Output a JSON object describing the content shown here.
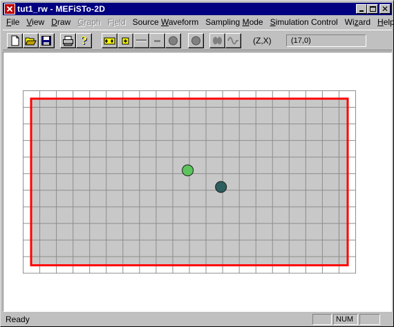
{
  "window": {
    "title": "tut1_rw - MEFiSTo-2D"
  },
  "menu": [
    {
      "pre": "",
      "u": "F",
      "post": "ile",
      "enabled": true
    },
    {
      "pre": "",
      "u": "V",
      "post": "iew",
      "enabled": true
    },
    {
      "pre": "",
      "u": "D",
      "post": "raw",
      "enabled": true
    },
    {
      "pre": "",
      "u": "G",
      "post": "raph",
      "enabled": false
    },
    {
      "pre": "F",
      "u": "i",
      "post": "eld",
      "enabled": false
    },
    {
      "pre": "Source ",
      "u": "W",
      "post": "aveform",
      "enabled": true
    },
    {
      "pre": "Sampling ",
      "u": "M",
      "post": "ode",
      "enabled": true
    },
    {
      "pre": "",
      "u": "S",
      "post": "imulation Control",
      "enabled": true
    },
    {
      "pre": "Wi",
      "u": "z",
      "post": "ard",
      "enabled": true
    },
    {
      "pre": "",
      "u": "H",
      "post": "elp",
      "enabled": true
    }
  ],
  "toolbar": {
    "coord_label": "(Z,X)",
    "coord_value": "(17,0)",
    "icons": [
      "new-file-icon",
      "open-folder-icon",
      "save-disk-icon",
      "print-icon",
      "help-question-icon",
      "add-node-pair-icon",
      "add-node-icon",
      "wall-line-icon",
      "boundary-line-icon",
      "source-icon",
      "probe-icon",
      "dual-source-icon",
      "waveform-icon"
    ]
  },
  "workspace": {
    "grid_cols": 20,
    "grid_rows": 11,
    "colors": {
      "background": "#ffffff",
      "mesh_fill": "#c8c8c8",
      "grid_line": "#8c8c8c",
      "boundary": "#ff0000",
      "source_marker": "#5cc45c",
      "probe_marker": "#2e5e5e"
    },
    "markers": [
      {
        "name": "source-marker",
        "col": 9,
        "row": 5
      },
      {
        "name": "probe-marker",
        "col": 11,
        "row": 6
      }
    ]
  },
  "status": {
    "text": "Ready",
    "num": "NUM"
  }
}
